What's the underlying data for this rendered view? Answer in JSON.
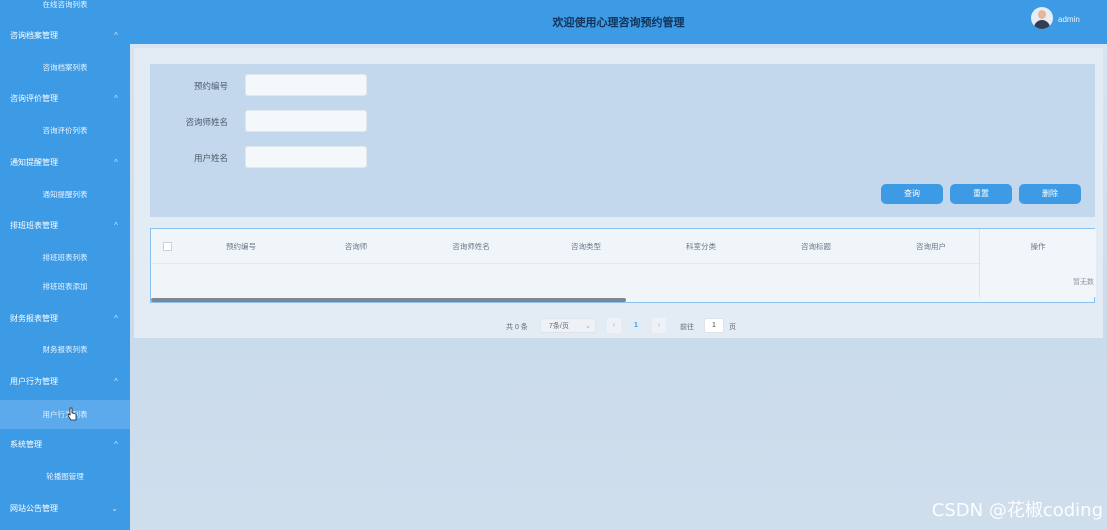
{
  "header": {
    "title": "欢迎使用心理咨询预约管理",
    "username": "admin"
  },
  "sidebar": {
    "items": [
      {
        "type": "sub",
        "label": "在线咨询列表"
      },
      {
        "type": "group",
        "label": "咨询档案管理"
      },
      {
        "type": "sub",
        "label": "咨询档案列表"
      },
      {
        "type": "group",
        "label": "咨询评价管理"
      },
      {
        "type": "sub",
        "label": "咨询评价列表"
      },
      {
        "type": "group",
        "label": "通知提醒管理"
      },
      {
        "type": "sub",
        "label": "通知提醒列表"
      },
      {
        "type": "group",
        "label": "排班班表管理"
      },
      {
        "type": "sub",
        "label": "排班班表列表"
      },
      {
        "type": "sub",
        "label": "排班班表添加"
      },
      {
        "type": "group",
        "label": "财务报表管理"
      },
      {
        "type": "sub",
        "label": "财务报表列表"
      },
      {
        "type": "group",
        "label": "用户行为管理"
      },
      {
        "type": "sub",
        "label": "用户行为列表",
        "active": true
      },
      {
        "type": "group",
        "label": "系统管理"
      },
      {
        "type": "sub",
        "label": "轮播图管理"
      },
      {
        "type": "group",
        "label": "网站公告管理"
      }
    ]
  },
  "search": {
    "fields": [
      {
        "label": "预约编号",
        "value": ""
      },
      {
        "label": "咨询师姓名",
        "value": ""
      },
      {
        "label": "用户姓名",
        "value": ""
      }
    ],
    "query_label": "查询",
    "reset_label": "重置",
    "delete_label": "删除"
  },
  "table": {
    "columns": [
      "预约编号",
      "咨询师",
      "咨询师姓名",
      "咨询类型",
      "科室分类",
      "咨询标题",
      "咨询用户"
    ],
    "operation_label": "操作",
    "empty_text": "暂无数",
    "rows": []
  },
  "pagination": {
    "total_text": "共 0 条",
    "page_size": "7条/页",
    "current_page": "1",
    "goto_label": "前往",
    "goto_value": "1",
    "page_unit": "页",
    "prev_glyph": "‹",
    "next_glyph": "›",
    "caret_glyph": "⌄"
  },
  "watermark": "CSDN @花椒coding",
  "arrows": {
    "up": "^",
    "down": "⌄"
  },
  "colors": {
    "primary": "#3d9be6",
    "accent_active": "#5ca9eb"
  }
}
